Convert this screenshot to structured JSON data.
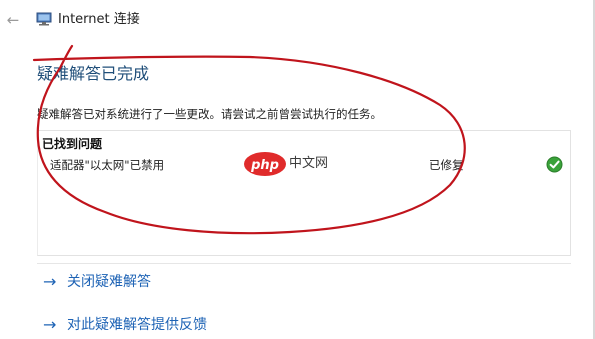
{
  "window": {
    "back_icon": "back-arrow-icon",
    "app_icon": "network-troubleshooter-icon",
    "title": "Internet 连接"
  },
  "main": {
    "heading": "疑难解答已完成",
    "description": "疑难解答已对系统进行了一些更改。请尝试之前曾尝试执行的任务。"
  },
  "problems": {
    "header": "已找到问题",
    "items": [
      {
        "name": "适配器\"以太网\"已禁用",
        "status": "已修复",
        "status_icon": "green-check-icon"
      }
    ]
  },
  "watermark": {
    "logo_text": "php",
    "text": "中文网"
  },
  "links": [
    {
      "icon": "arrow-right-icon",
      "label": "关闭疑难解答"
    },
    {
      "icon": "arrow-right-icon",
      "label": "对此疑难解答提供反馈"
    }
  ],
  "colors": {
    "accent_link": "#1e63b5",
    "heading": "#1f4e79",
    "annotation": "#c0141c",
    "success": "#3aa23a"
  }
}
